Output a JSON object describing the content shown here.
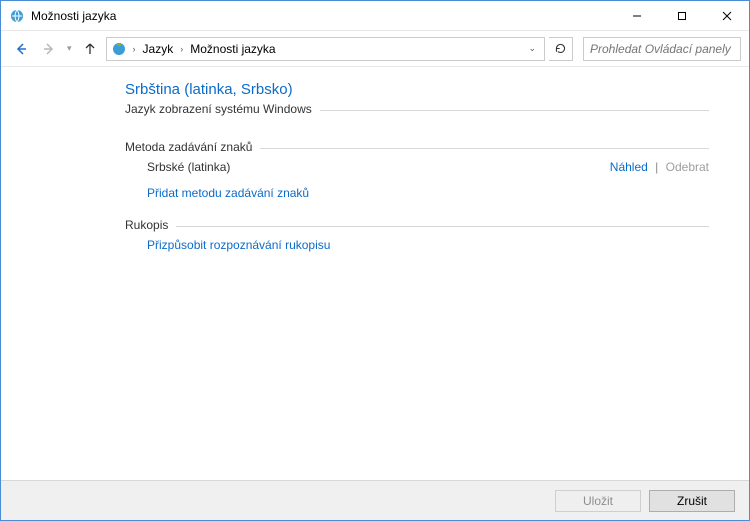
{
  "window": {
    "title": "Možnosti jazyka"
  },
  "breadcrumb": {
    "root_chevron": "›",
    "items": [
      "Jazyk",
      "Možnosti jazyka"
    ]
  },
  "search": {
    "placeholder": "Prohledat Ovládací panely"
  },
  "page": {
    "title": "Srbština (latinka, Srbsko)",
    "display_language_section": "Jazyk zobrazení systému Windows",
    "input_method_section": "Metoda zadávání znaků",
    "input_methods": [
      {
        "name": "Srbské (latinka)",
        "preview": "Náhled",
        "remove": "Odebrat"
      }
    ],
    "separator": "|",
    "add_input_method": "Přidat metodu zadávání znaků",
    "handwriting_section": "Rukopis",
    "handwriting_link": "Přizpůsobit rozpoznávání rukopisu"
  },
  "footer": {
    "save": "Uložit",
    "cancel": "Zrušit"
  }
}
